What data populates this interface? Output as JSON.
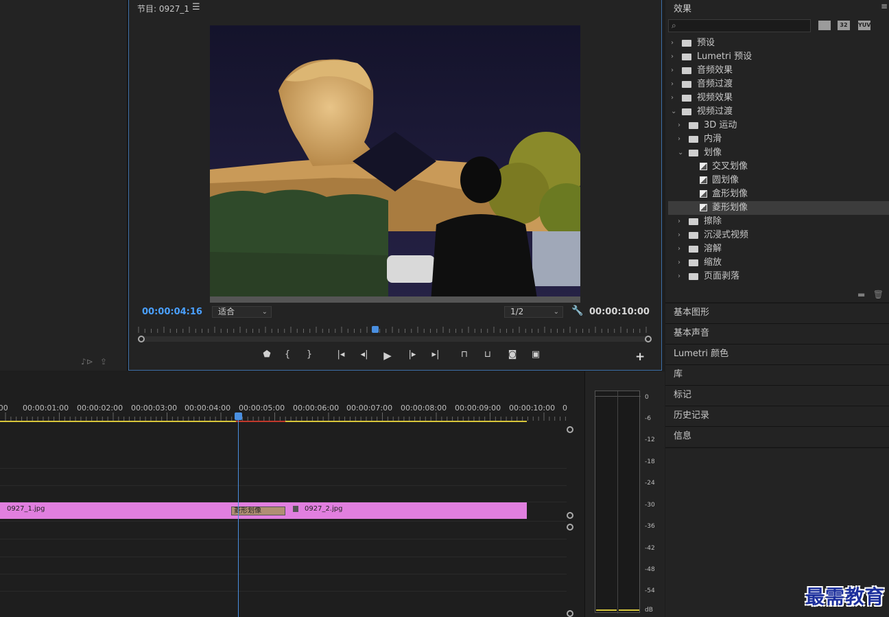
{
  "program_monitor": {
    "title": "节目: 0927_1",
    "menu_icon": "hamburger-icon",
    "current_time": "00:00:04:16",
    "duration": "00:00:10:00",
    "fit_select": "适合",
    "resolution_select": "1/2",
    "transport_icons": [
      "marker-icon",
      "mark-in-icon",
      "mark-out-icon",
      "go-to-in-icon",
      "step-back-icon",
      "play-icon",
      "step-forward-icon",
      "go-to-out-icon",
      "lift-icon",
      "extract-icon",
      "export-frame-icon",
      "compare-icon"
    ],
    "add_button": "+"
  },
  "effects_panel": {
    "title": "效果",
    "header_icons": [
      "accelerated-effects-icon",
      "32-bit-icon",
      "yuv-icon"
    ],
    "header_icon_labels": [
      "",
      "32",
      "YUV"
    ],
    "tree": [
      {
        "label": "预设",
        "level": 0,
        "expanded": false,
        "type": "preset-folder"
      },
      {
        "label": "Lumetri 预设",
        "level": 0,
        "expanded": false,
        "type": "preset-folder"
      },
      {
        "label": "音频效果",
        "level": 0,
        "expanded": false,
        "type": "folder"
      },
      {
        "label": "音频过渡",
        "level": 0,
        "expanded": false,
        "type": "folder"
      },
      {
        "label": "视频效果",
        "level": 0,
        "expanded": false,
        "type": "folder"
      },
      {
        "label": "视频过渡",
        "level": 0,
        "expanded": true,
        "type": "folder"
      },
      {
        "label": "3D 运动",
        "level": 1,
        "expanded": false,
        "type": "folder"
      },
      {
        "label": "内滑",
        "level": 1,
        "expanded": false,
        "type": "folder"
      },
      {
        "label": "划像",
        "level": 1,
        "expanded": true,
        "type": "folder"
      },
      {
        "label": "交叉划像",
        "level": 2,
        "type": "effect"
      },
      {
        "label": "圆划像",
        "level": 2,
        "type": "effect"
      },
      {
        "label": "盒形划像",
        "level": 2,
        "type": "effect"
      },
      {
        "label": "菱形划像",
        "level": 2,
        "type": "effect",
        "selected": true
      },
      {
        "label": "擦除",
        "level": 1,
        "expanded": false,
        "type": "folder"
      },
      {
        "label": "沉浸式视频",
        "level": 1,
        "expanded": false,
        "type": "folder"
      },
      {
        "label": "溶解",
        "level": 1,
        "expanded": false,
        "type": "folder"
      },
      {
        "label": "缩放",
        "level": 1,
        "expanded": false,
        "type": "folder"
      },
      {
        "label": "页面剥落",
        "level": 1,
        "expanded": false,
        "type": "folder"
      }
    ]
  },
  "side_panels": [
    "基本图形",
    "基本声音",
    "Lumetri 颜色",
    "库",
    "标记",
    "历史记录",
    "信息"
  ],
  "timeline": {
    "ruler_labels": [
      ":00",
      "00:00:01:00",
      "00:00:02:00",
      "00:00:03:00",
      "00:00:04:00",
      "00:00:05:00",
      "00:00:06:00",
      "00:00:07:00",
      "00:00:08:00",
      "00:00:09:00",
      "00:00:10:00",
      "0"
    ],
    "clips": [
      {
        "label": "0927_1.jpg",
        "color": "#e17fdf"
      },
      {
        "label": "0927_2.jpg",
        "color": "#e17fdf"
      }
    ],
    "transition_label": "菱形划像"
  },
  "audio_meter": {
    "db_labels": [
      "0",
      "-6",
      "-12",
      "-18",
      "-24",
      "-30",
      "-36",
      "-42",
      "-48",
      "-54",
      "dB"
    ]
  },
  "watermark": "最需教育",
  "colors": {
    "accent_blue": "#4aa0ff",
    "clip_pink": "#e17fdf",
    "work_area_yellow": "#d8c63a",
    "render_red": "#c0392b",
    "transition_tan": "#b08f73"
  }
}
